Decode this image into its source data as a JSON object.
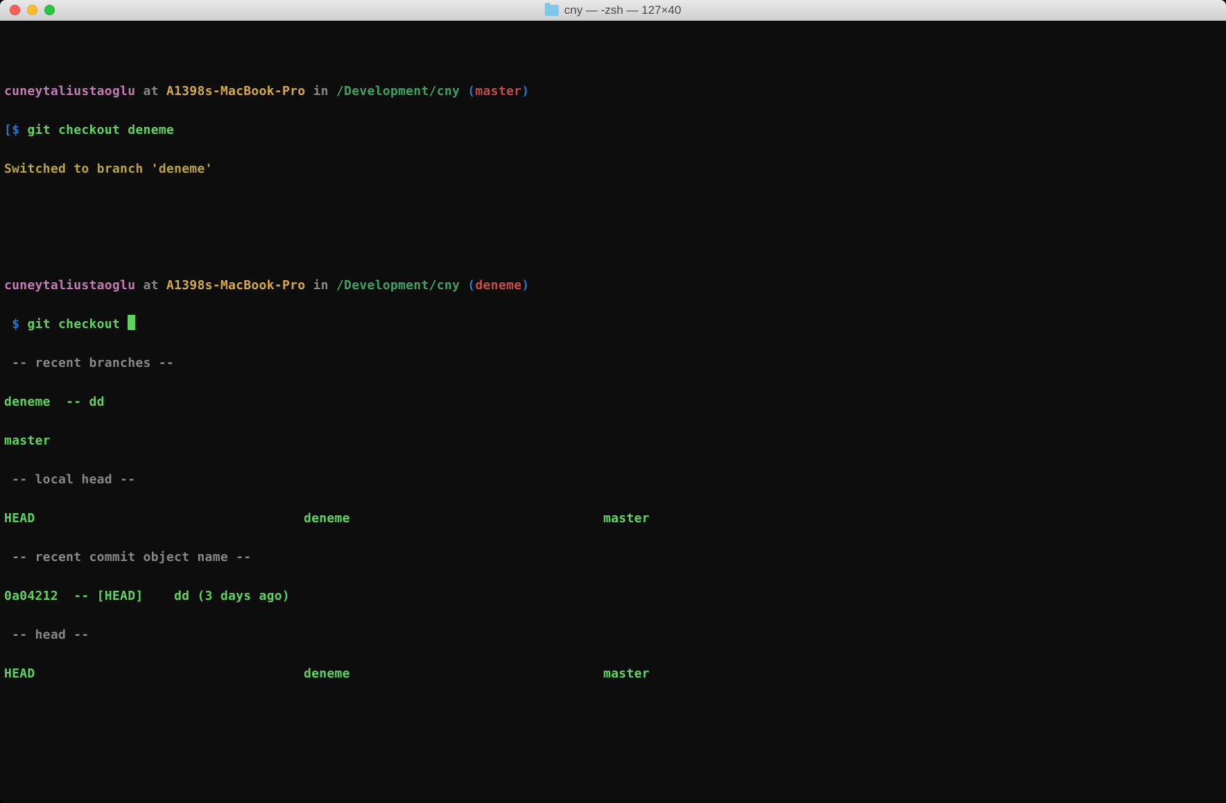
{
  "window": {
    "title": "cny — -zsh — 127×40"
  },
  "terminal": {
    "blank": " ",
    "prompts": [
      {
        "user": "cuneytaliustaoglu",
        "at": " at ",
        "host": "A1398s-MacBook-Pro",
        "in": " in ",
        "path": "/Development/cny",
        "paren_open": " (",
        "branch": "master",
        "paren_close": ")"
      },
      {
        "user": "cuneytaliustaoglu",
        "at": " at ",
        "host": "A1398s-MacBook-Pro",
        "in": " in ",
        "path": "/Development/cny",
        "paren_open": " (",
        "branch": "deneme",
        "paren_close": ")"
      }
    ],
    "cmd1_prefix": "[$ ",
    "cmd1": "git checkout deneme",
    "output1": "Switched to branch 'deneme'",
    "cmd2_prefix": " $ ",
    "cmd2": "git checkout ",
    "sections": {
      "recent_branches": " -- recent branches --",
      "local_head": " -- local head --",
      "recent_commit": " -- recent commit object name --",
      "head": " -- head --"
    },
    "recent": {
      "deneme": "deneme  -- dd",
      "master": "master"
    },
    "cols": {
      "head": "HEAD",
      "deneme": "deneme",
      "master": "master"
    },
    "commit": "0a04212  -- [HEAD]    dd (3 days ago)"
  }
}
